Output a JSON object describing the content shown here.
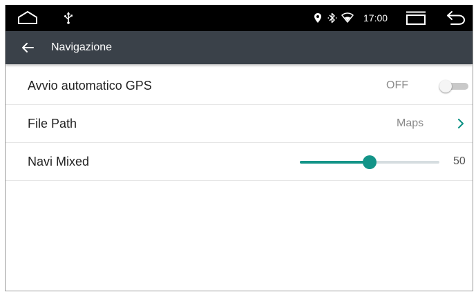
{
  "status_bar": {
    "time": "17:00",
    "icons": [
      "home-icon",
      "usb-icon",
      "location-icon",
      "bluetooth-icon",
      "wifi-icon",
      "recent-apps-icon",
      "back-arrow-icon"
    ]
  },
  "app_bar": {
    "title": "Navigazione",
    "back_icon": "arrow-left-icon",
    "color": "#3a4149"
  },
  "settings": {
    "gps_autostart": {
      "label": "Avvio automatico GPS",
      "value": "OFF",
      "enabled": false
    },
    "file_path": {
      "label": "File Path",
      "value": "Maps"
    },
    "navi_mixed": {
      "label": "Navi Mixed",
      "value": "50",
      "fraction": 0.5
    }
  },
  "colors": {
    "accent": "#139488",
    "status_bar": "#000000",
    "chevron": "#139488"
  }
}
